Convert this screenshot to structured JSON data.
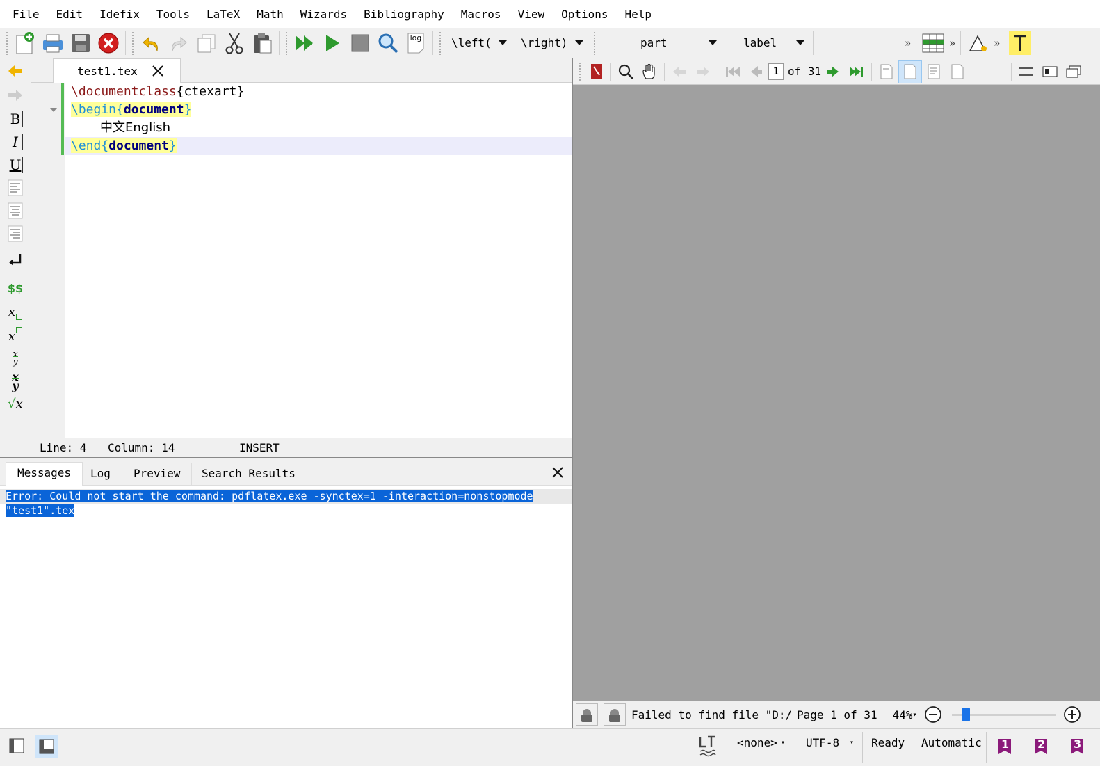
{
  "menu": [
    "File",
    "Edit",
    "Idefix",
    "Tools",
    "LaTeX",
    "Math",
    "Wizards",
    "Bibliography",
    "Macros",
    "View",
    "Options",
    "Help"
  ],
  "toolbar": {
    "left_combo": "\\left(",
    "right_combo": "\\right)",
    "structure_combo": "part",
    "ref_combo": "label",
    "log_label": "log"
  },
  "editor": {
    "tab_title": "test1.tex",
    "line1_cmd": "\\documentclass",
    "line1_arg": "{ctexart}",
    "line2_cmd": "\\begin",
    "line2_open": "{",
    "line2_env": "document",
    "line2_close": "}",
    "line3_text": "中文English",
    "line4_cmd": "\\end",
    "line4_open": "{",
    "line4_env": "document",
    "line4_close": "}"
  },
  "status": {
    "line": "Line: 4",
    "column": "Column: 14",
    "mode": "INSERT"
  },
  "messages": {
    "tabs": [
      "Messages",
      "Log",
      "Preview",
      "Search Results"
    ],
    "error_line1": "Error: Could not start the command: pdflatex.exe -synctex=1 -interaction=nonstopmode",
    "error_line2": "\"test1\".tex"
  },
  "pdf": {
    "page_input": "1",
    "page_of": "of 31",
    "status_msg": "Failed to find file \"D:/dc",
    "page_info": "Page 1 of 31",
    "zoom": "44%",
    "zoom_level": 0.1
  },
  "bottom": {
    "encoding_mode": "<none>",
    "encoding": "UTF-8",
    "ready": "Ready",
    "automatic": "Automatic",
    "bookmarks": [
      "1",
      "2",
      "3"
    ]
  },
  "colors": {
    "selection": "#0a64d8",
    "pdf_bg": "#a0a0a0",
    "green": "#2e9a2e"
  }
}
